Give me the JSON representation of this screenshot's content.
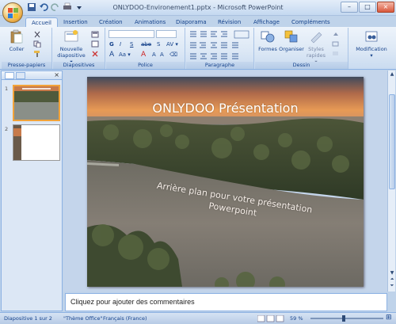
{
  "window": {
    "title": "ONLYDOO-Environement1.pptx - Microsoft PowerPoint",
    "controls": [
      "–",
      "□",
      "×"
    ]
  },
  "tabs": [
    "Accueil",
    "Insertion",
    "Création",
    "Animations",
    "Diaporama",
    "Révision",
    "Affichage",
    "Compléments"
  ],
  "ribbon": {
    "clipboard": {
      "paste": "Coller",
      "label": "Presse-papiers"
    },
    "slides": {
      "new_slide_1": "Nouvelle",
      "new_slide_2": "diapositive ▾",
      "label": "Diapositives"
    },
    "font": {
      "bold": "G",
      "italic": "I",
      "underline": "S",
      "strike": "abe",
      "shadow": "S",
      "spacing": "AV ▾",
      "case": "Aa ▾",
      "label": "Police"
    },
    "paragraph": {
      "label": "Paragraphe"
    },
    "drawing": {
      "shapes": "Formes",
      "arrange": "Organiser",
      "styles_1": "Styles",
      "styles_2": "rapides ▾",
      "label": "Dessin"
    },
    "editing": {
      "modify": "Modification"
    }
  },
  "thumbnails": [
    {
      "num": "1",
      "selected": true
    },
    {
      "num": "2",
      "selected": false
    }
  ],
  "slide": {
    "title": "ONLYDOO Présentation",
    "subtitle_1": "Arrière plan pour votre présentation",
    "subtitle_2": "Powerpoint"
  },
  "notes": {
    "placeholder": "Cliquez pour ajouter des commentaires"
  },
  "status": {
    "slide": "Diapositive 1 sur 2",
    "theme": "\"Thème Office\"",
    "language": "Français (France)",
    "zoom": "59 %"
  },
  "colors": {
    "ribbon_bg": "#dbe7f5",
    "accent": "#15428b",
    "selection": "#f2a33a"
  }
}
